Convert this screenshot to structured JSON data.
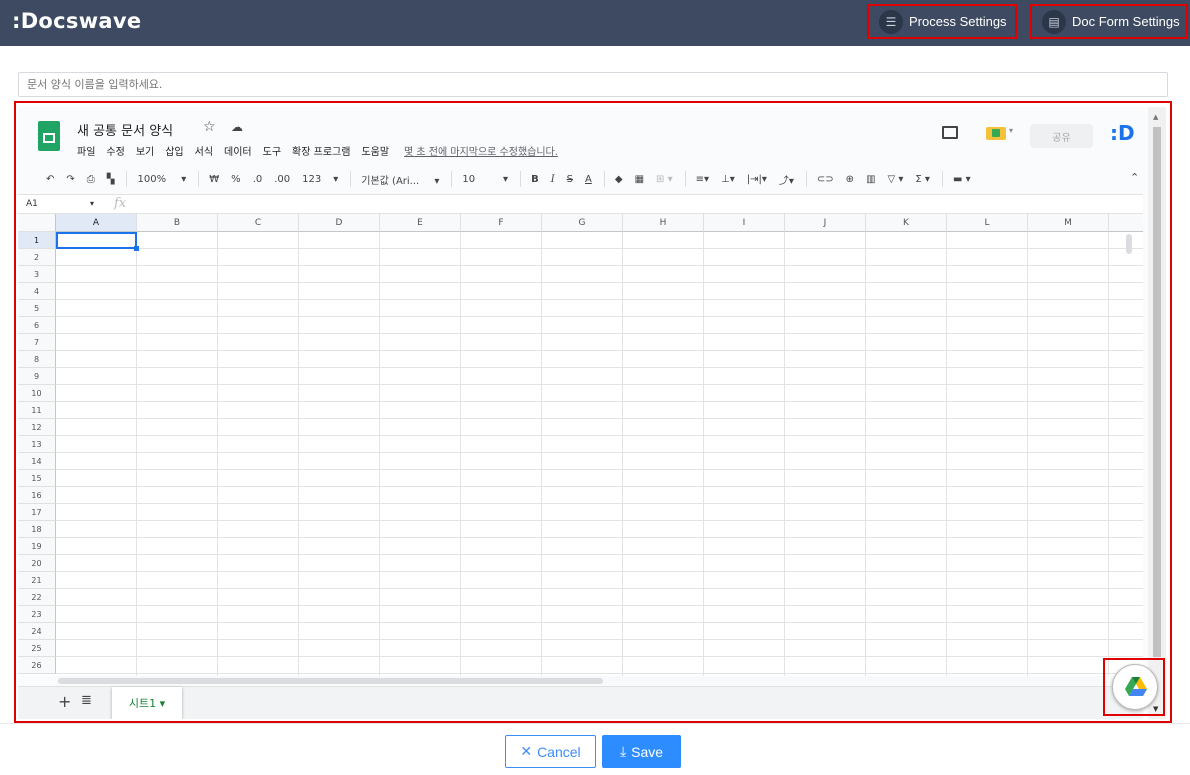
{
  "app": {
    "logo": ":Docswave"
  },
  "header": {
    "process_settings": "Process Settings",
    "doc_form_settings": "Doc Form Settings"
  },
  "form_name": {
    "placeholder": "문서 양식 이름을 입력하세요."
  },
  "sheet": {
    "title": "새 공통 문서 양식",
    "menu": [
      "파일",
      "수정",
      "보기",
      "삽입",
      "서식",
      "데이터",
      "도구",
      "확장 프로그램",
      "도움말"
    ],
    "last_edit": "몇 초 전에 마지막으로 수정했습니다.",
    "share_label": "공유",
    "toolbar": {
      "zoom": "100%",
      "currency": "₩",
      "percent": "%",
      "dec_down": ".0",
      "dec_up": ".00",
      "format_123": "123",
      "font": "기본값 (Ari...",
      "font_size": "10"
    },
    "cell_ref": "A1",
    "columns": [
      "A",
      "B",
      "C",
      "D",
      "E",
      "F",
      "G",
      "H",
      "I",
      "J",
      "K",
      "L",
      "M"
    ],
    "rows": [
      "1",
      "2",
      "3",
      "4",
      "5",
      "6",
      "7",
      "8",
      "9",
      "10",
      "11",
      "12",
      "13",
      "14",
      "15",
      "16",
      "17",
      "18",
      "19",
      "20",
      "21",
      "22",
      "23",
      "24",
      "25",
      "26"
    ],
    "active_tab": "시트1"
  },
  "footer": {
    "cancel": "Cancel",
    "save": "Save"
  },
  "colors": {
    "topbar": "#3d4a61",
    "highlight": "#e00000",
    "primary": "#2d8cff",
    "sheets_green": "#1fa463"
  }
}
